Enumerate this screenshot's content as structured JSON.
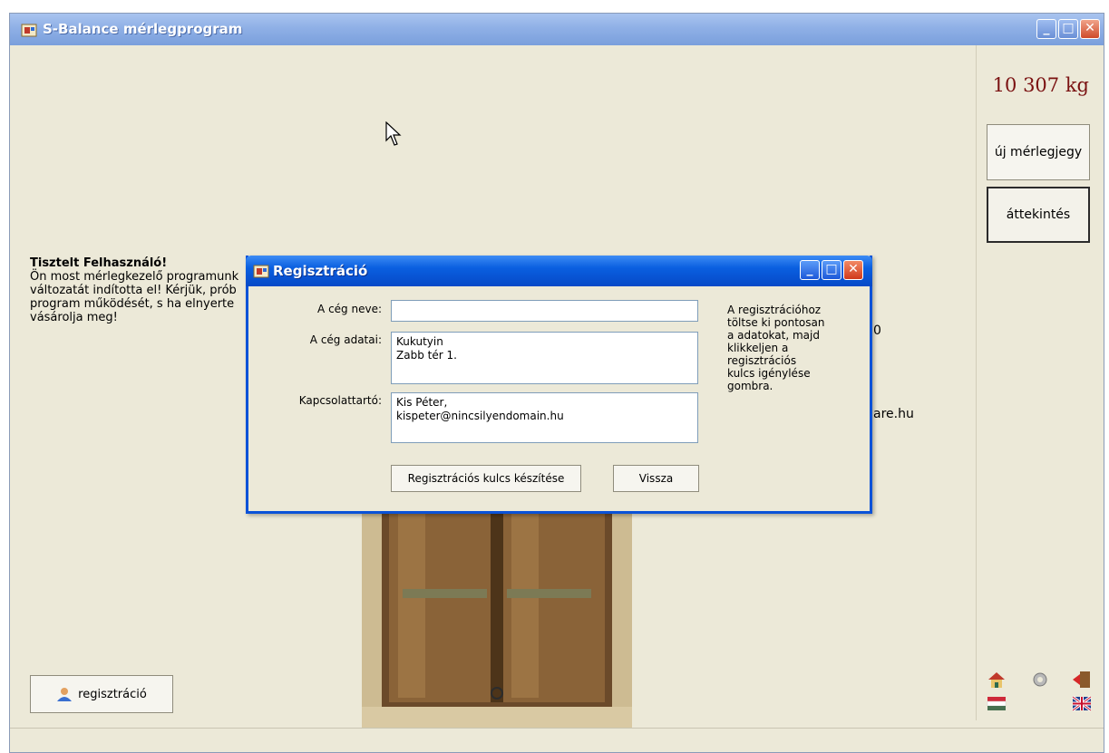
{
  "main_window": {
    "title": "S-Balance mérlegprogram",
    "weight_display": "10 307 kg",
    "side_buttons": {
      "new_ticket": "új mérlegjegy",
      "overview": "áttekintés"
    },
    "intro": {
      "heading": "Tisztelt Felhasználó!",
      "line1": "Ön most mérlegkezelő programunk",
      "line2": "változatát indította el! Kérjük, prób",
      "line3": "program működését, s ha elnyerte",
      "line4": "vásárolja meg!"
    },
    "register_button": "regisztráció",
    "bg_fragment_1": "0",
    "bg_fragment_2": "are.hu"
  },
  "dialog": {
    "title": "Regisztráció",
    "labels": {
      "company_name": "A cég neve:",
      "company_data": "A cég adatai:",
      "contact": "Kapcsolattartó:"
    },
    "values": {
      "company_name": "",
      "company_data": "Kukutyin\nZabb tér 1.",
      "contact": "Kis Péter,\nkispeter@nincsilyendomain.hu"
    },
    "hint": "A regisztrációhoz töltse ki pontosan a adatokat, majd klikkeljen a regisztrációs kulcs igénylése gombra.",
    "buttons": {
      "generate_key": "Regisztrációs kulcs készítése",
      "back": "Vissza"
    }
  },
  "colors": {
    "weight": "#7a1111",
    "dialog_title": "#0a5fe0",
    "main_title": "#8fb0e6"
  }
}
